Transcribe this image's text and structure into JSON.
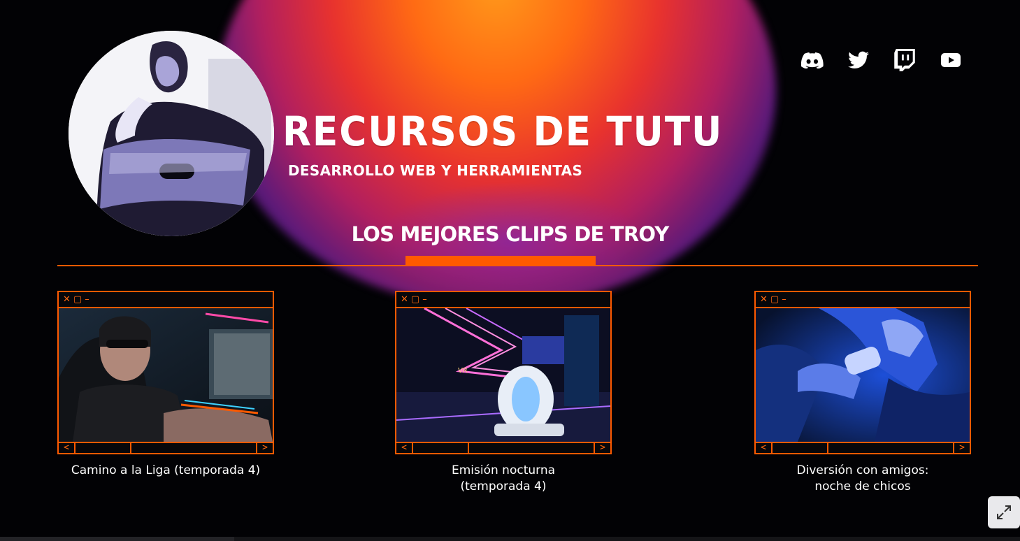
{
  "header": {
    "brand": "RECURSOS DE TUTU",
    "tagline": "DESARROLLO WEB Y HERRAMIENTAS"
  },
  "social": [
    {
      "icon": "discord-icon"
    },
    {
      "icon": "twitter-icon"
    },
    {
      "icon": "twitch-icon"
    },
    {
      "icon": "youtube-icon"
    }
  ],
  "section": {
    "title": "LOS MEJORES CLIPS DE TROY"
  },
  "window_controls": {
    "close": "✕",
    "maximize": "▢",
    "minimize": "–"
  },
  "nav": {
    "prev": "<",
    "next": ">"
  },
  "clips": [
    {
      "caption": "Camino a la Liga (temporada 4)",
      "caption_line2": ""
    },
    {
      "caption": "Emisión nocturna",
      "caption_line2": "(temporada 4)"
    },
    {
      "caption": "Diversión con amigos:",
      "caption_line2": "noche de chicos"
    }
  ],
  "colors": {
    "accent": "#ff5a00",
    "background": "#020205",
    "text": "#ffffff"
  }
}
